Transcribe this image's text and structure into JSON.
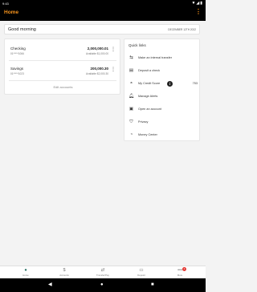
{
  "status_bar": {
    "time": "9:43",
    "icons": "▼◢▮"
  },
  "app_bar": {
    "title": "Home",
    "menu_icon": "more-vert-icon"
  },
  "greeting": {
    "text": "Good morning",
    "date": "DECEMBER 12TH 2022"
  },
  "accounts": [
    {
      "name": "Checking",
      "number": "01*****1066",
      "balance": "2,000,000.01",
      "available": "Available $1,000.00"
    },
    {
      "name": "Savings",
      "number": "01*****1023",
      "balance": "200,000.30",
      "available": "Available $2,000.30"
    }
  ],
  "edit_accounts_label": "Edit accounts",
  "quick_links": {
    "title": "Quick links",
    "items": [
      {
        "label": "Make an internal transfer",
        "icon": "transfer-icon"
      },
      {
        "label": "Deposit a check",
        "icon": "check-deposit-icon"
      },
      {
        "label": "My Credit Score",
        "icon": "credit-score-icon",
        "badge": "i",
        "value": "753"
      },
      {
        "label": "Manage Alerts",
        "icon": "bell-icon"
      },
      {
        "label": "Open an account",
        "icon": "open-account-icon"
      },
      {
        "label": "Privacy",
        "icon": "shield-icon"
      },
      {
        "label": "Money Center",
        "icon": "money-center-icon"
      }
    ]
  },
  "bottom_nav": [
    {
      "label": "Home",
      "icon": "home-icon",
      "active": true
    },
    {
      "label": "Accounts",
      "icon": "dollar-icon"
    },
    {
      "label": "Transfer/Pay",
      "icon": "transfer-pay-icon"
    },
    {
      "label": "Deposit",
      "icon": "deposit-icon"
    },
    {
      "label": "More",
      "icon": "more-horiz-icon",
      "badge": "1"
    }
  ]
}
